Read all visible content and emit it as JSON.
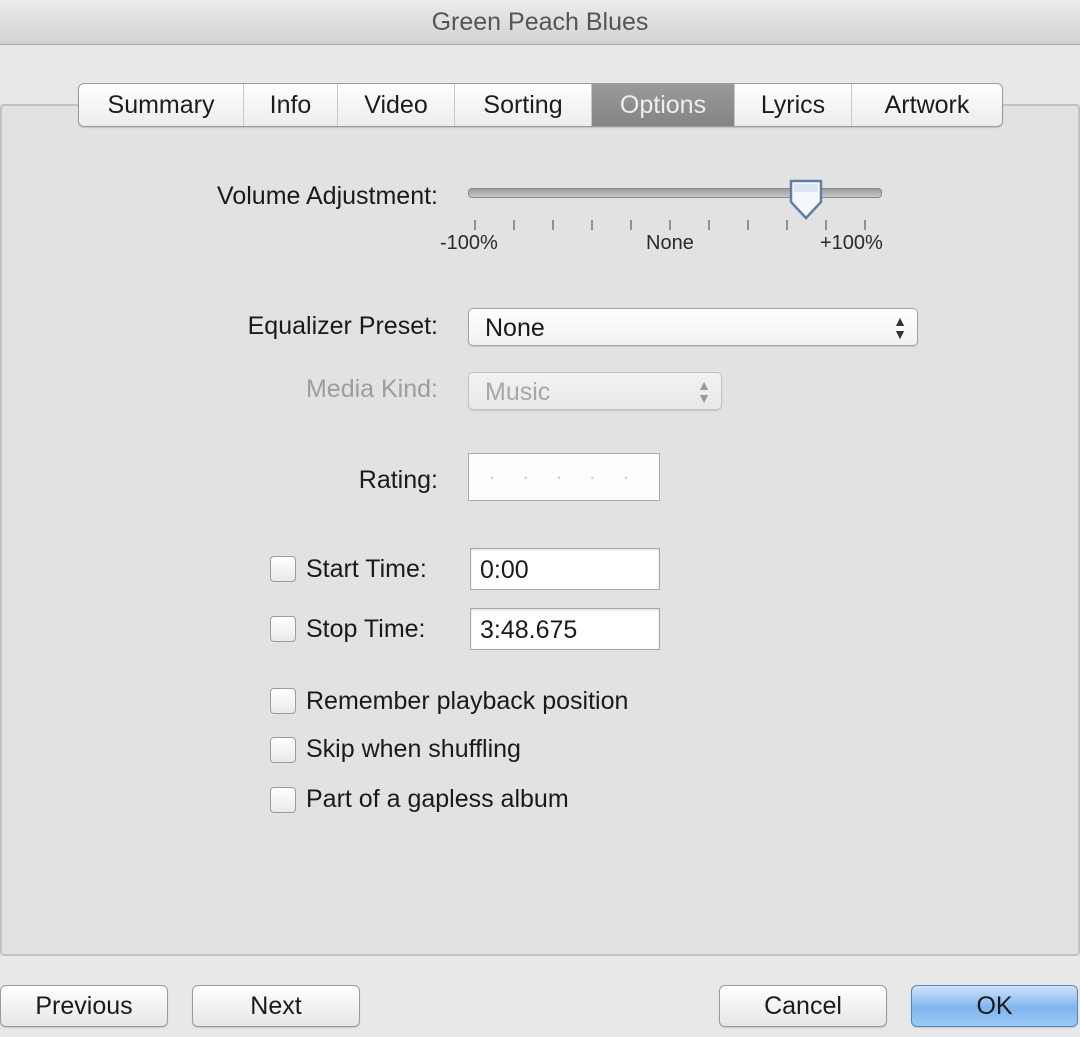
{
  "window": {
    "title": "Green Peach Blues"
  },
  "tabs": [
    {
      "label": "Summary",
      "active": false
    },
    {
      "label": "Info",
      "active": false
    },
    {
      "label": "Video",
      "active": false
    },
    {
      "label": "Sorting",
      "active": false
    },
    {
      "label": "Options",
      "active": true
    },
    {
      "label": "Lyrics",
      "active": false
    },
    {
      "label": "Artwork",
      "active": false
    }
  ],
  "volume": {
    "label": "Volume Adjustment:",
    "min_label": "-100%",
    "mid_label": "None",
    "max_label": "+100%",
    "value_percent": 70
  },
  "equalizer": {
    "label": "Equalizer Preset:",
    "value": "None"
  },
  "media_kind": {
    "label": "Media Kind:",
    "value": "Music",
    "enabled": false
  },
  "rating": {
    "label": "Rating:",
    "stars_filled": 0,
    "placeholder": "· · · · ·"
  },
  "start_time": {
    "label": "Start Time:",
    "checked": false,
    "value": "0:00"
  },
  "stop_time": {
    "label": "Stop Time:",
    "checked": false,
    "value": "3:48.675"
  },
  "options": [
    {
      "label": "Remember playback position",
      "checked": false
    },
    {
      "label": "Skip when shuffling",
      "checked": false
    },
    {
      "label": "Part of a gapless album",
      "checked": false
    }
  ],
  "buttons": {
    "previous": "Previous",
    "next": "Next",
    "cancel": "Cancel",
    "ok": "OK"
  },
  "colors": {
    "active_tab": "#8e8e8e",
    "default_button": "#7fb4ee"
  }
}
